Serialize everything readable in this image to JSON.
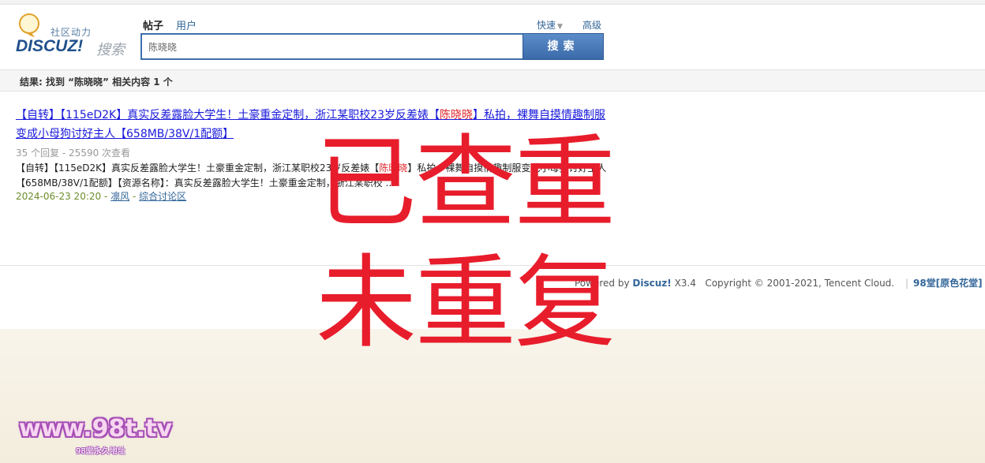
{
  "header": {
    "logo_sub": "社区动力",
    "logo_main": "DISCUZ!",
    "logo_search": "搜索",
    "tabs": [
      {
        "label": "帖子",
        "active": true
      },
      {
        "label": "用户",
        "active": false
      }
    ],
    "quick_label": "快速",
    "advanced_label": "高级",
    "search_value": "陈晓晓",
    "search_button": "搜索"
  },
  "results": {
    "summary": "结果: 找到 “陈晓晓” 相关内容 1 个",
    "items": [
      {
        "title_before": "【自转】【115eD2K】真实反差露脸大学生！土豪重金定制，浙江某职校23岁反差婊【",
        "title_highlight": "陈晓晓",
        "title_after": "】私拍，裸舞自摸情趣制服变成小母狗讨好主人【658MB/38V/1配额】",
        "stats": "35 个回复 - 25590 次查看",
        "desc_before": "【自转】【115eD2K】真实反差露脸大学生！土豪重金定制，浙江某职校23岁反差婊【",
        "desc_highlight": "陈晓晓",
        "desc_after": "】私拍，裸舞自摸情趣制服变成小母狗讨好主人【658MB/38V/1配额】【资源名称】：真实反差露脸大学生！土豪重金定制，浙江某职校 ...",
        "date": "2024-06-23 20:20",
        "author": "凛风",
        "forum": "综合讨论区"
      }
    ]
  },
  "footer": {
    "powered_prefix": "Powered by",
    "powered_brand": "Discuz!",
    "version": "X3.4",
    "copyright": "Copyright © 2001-2021, Tencent Cloud.",
    "site_link": "98堂[原色花堂]"
  },
  "overlay": {
    "line1": "已查重",
    "line2": "未重复",
    "color": "#e81d2c"
  },
  "watermark": {
    "main": "www.98t.tv",
    "sub": "98堂永久地址"
  }
}
